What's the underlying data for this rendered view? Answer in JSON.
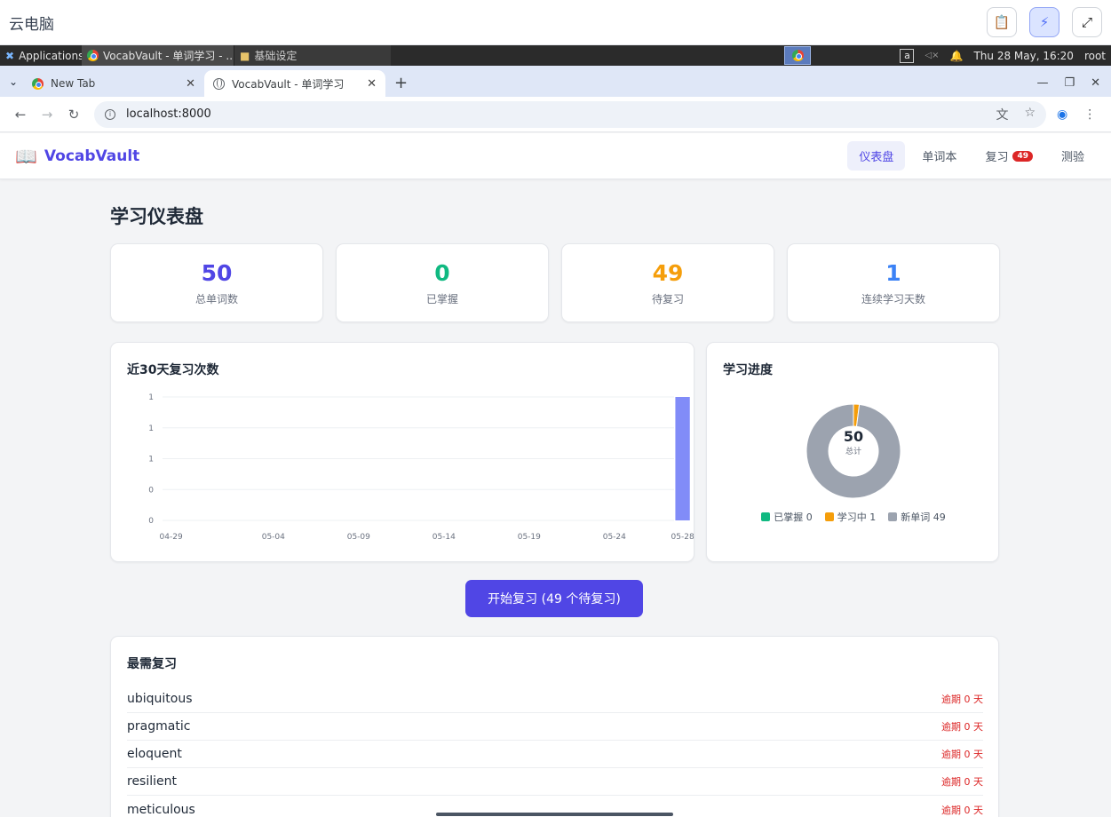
{
  "outer": {
    "title": "云电脑"
  },
  "taskbar": {
    "applications": "Applications",
    "window1": "VocabVault - 单词学习 - ...",
    "window2": "基础设定",
    "tray_letter": "a",
    "datetime": "Thu 28 May, 16:20",
    "user": "root"
  },
  "browser": {
    "tabs": [
      {
        "label": "New Tab"
      },
      {
        "label": "VocabVault - 单词学习"
      }
    ],
    "url": "localhost:8000"
  },
  "app": {
    "brand": "VocabVault",
    "nav": [
      {
        "label": "仪表盘"
      },
      {
        "label": "单词本"
      },
      {
        "label": "复习",
        "badge": "49"
      },
      {
        "label": "测验"
      }
    ]
  },
  "dashboard": {
    "title": "学习仪表盘",
    "stats": [
      {
        "value": "50",
        "label": "总单词数",
        "color": "#5046e5"
      },
      {
        "value": "0",
        "label": "已掌握",
        "color": "#10b981"
      },
      {
        "value": "49",
        "label": "待复习",
        "color": "#f59e0b"
      },
      {
        "value": "1",
        "label": "连续学习天数",
        "color": "#3b82f6"
      }
    ],
    "start_button": "开始复习 (49 个待复习)",
    "most_review": {
      "title": "最需复习",
      "items": [
        {
          "word": "ubiquitous",
          "status": "逾期 0 天"
        },
        {
          "word": "pragmatic",
          "status": "逾期 0 天"
        },
        {
          "word": "eloquent",
          "status": "逾期 0 天"
        },
        {
          "word": "resilient",
          "status": "逾期 0 天"
        },
        {
          "word": "meticulous",
          "status": "逾期 0 天"
        }
      ]
    }
  },
  "chart_data": [
    {
      "type": "bar",
      "title": "近30天复习次数",
      "x_tick_labels": [
        "04-29",
        "05-04",
        "05-09",
        "05-14",
        "05-19",
        "05-24",
        "05-28"
      ],
      "y_tick_labels": [
        "1",
        "1",
        "1",
        "0",
        "0"
      ],
      "ylim": [
        0,
        1
      ],
      "points": [
        {
          "x": "05-28",
          "y": 1
        }
      ],
      "bar_color": "#818cf8",
      "grid": true
    },
    {
      "type": "pie",
      "title": "学习进度",
      "center_value": "50",
      "center_label": "总计",
      "slices": [
        {
          "label": "已掌握",
          "value": 0,
          "color": "#10b981"
        },
        {
          "label": "学习中",
          "value": 1,
          "color": "#f59e0b"
        },
        {
          "label": "新单词",
          "value": 49,
          "color": "#9ca3af"
        }
      ]
    }
  ]
}
